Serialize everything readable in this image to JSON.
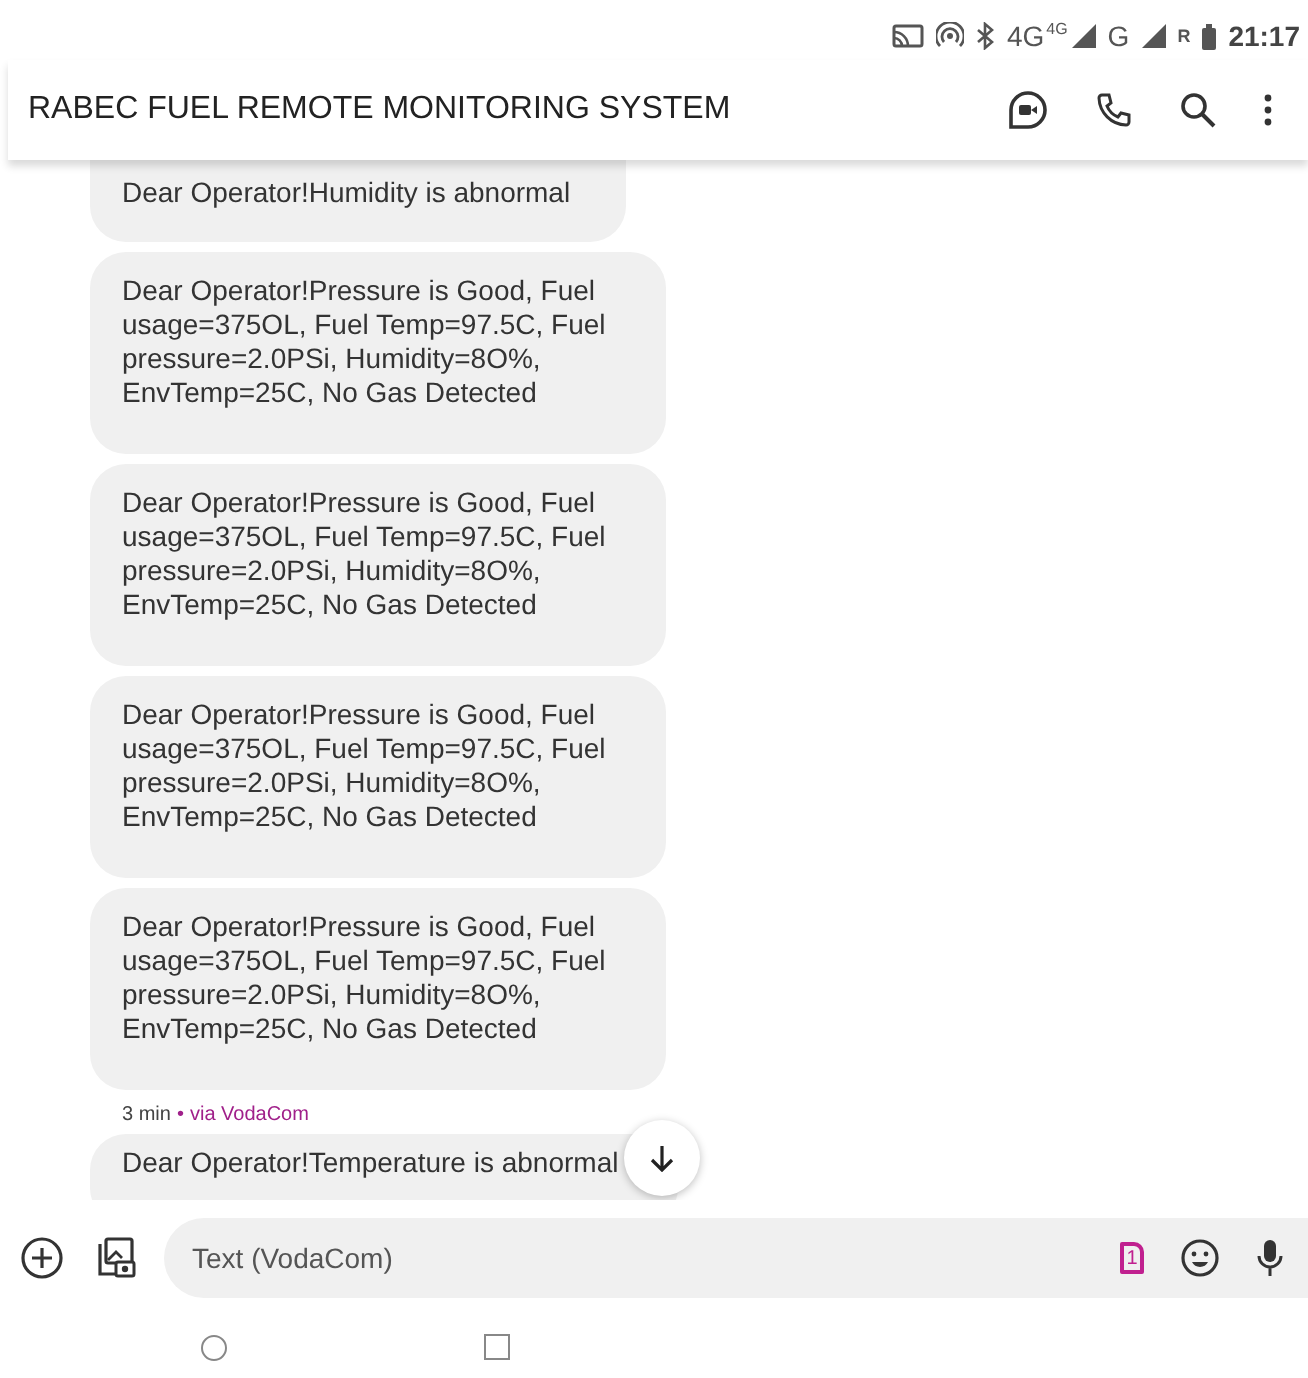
{
  "status_bar": {
    "network": "4G",
    "network_small": "4G",
    "network_2": "G",
    "roaming": "R",
    "time": "21:17"
  },
  "header": {
    "title": "RABEC FUEL REMOTE MONITORING SYSTEM"
  },
  "messages": [
    {
      "text": "Dear Operator!Humidity is abnormal"
    },
    {
      "text": "Dear Operator!Pressure is Good, Fuel usage=375OL, Fuel Temp=97.5C, Fuel pressure=2.0PSi, Humidity=8O%, EnvTemp=25C, No Gas Detected"
    },
    {
      "text": "Dear Operator!Pressure is Good, Fuel usage=375OL, Fuel Temp=97.5C, Fuel pressure=2.0PSi, Humidity=8O%, EnvTemp=25C, No Gas Detected"
    },
    {
      "text": "Dear Operator!Pressure is Good, Fuel usage=375OL, Fuel Temp=97.5C, Fuel pressure=2.0PSi, Humidity=8O%, EnvTemp=25C, No Gas Detected"
    },
    {
      "text": "Dear Operator!Pressure is Good, Fuel usage=375OL, Fuel Temp=97.5C, Fuel pressure=2.0PSi, Humidity=8O%, EnvTemp=25C, No Gas Detected"
    },
    {
      "time": "3 min",
      "separator": "•",
      "via": "via VodaCom",
      "text": "Dear Operator!Temperature is abnormal"
    }
  ],
  "compose": {
    "placeholder": "Text (VodaCom)",
    "sim": "1"
  }
}
